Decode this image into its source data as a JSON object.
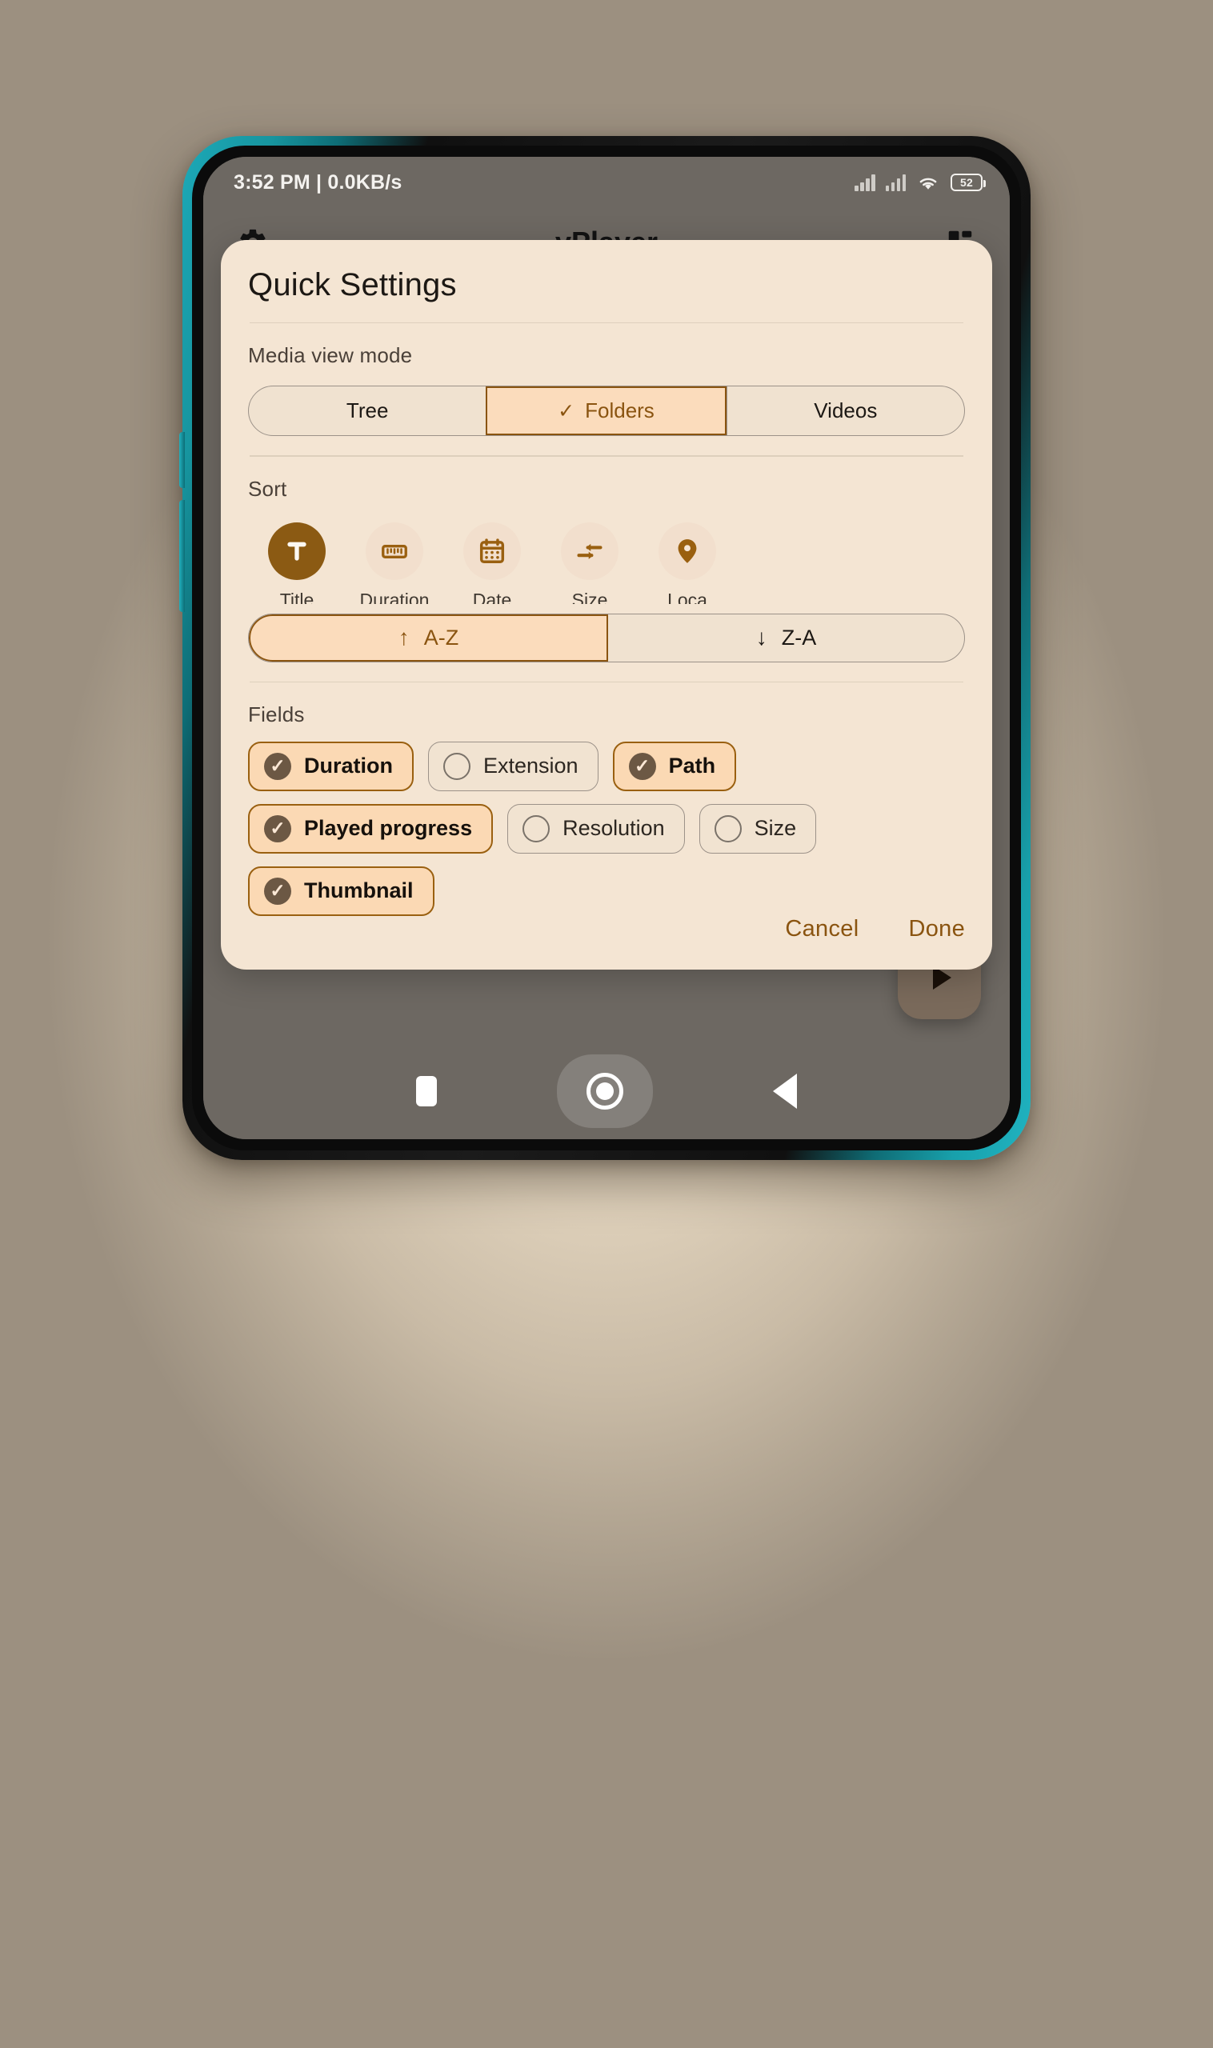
{
  "status_bar": {
    "time_and_speed": "3:52 PM | 0.0KB/s",
    "battery_level": "52",
    "icons": [
      "signal-bars-icon",
      "signal-bars-icon",
      "wifi-icon",
      "battery-icon"
    ]
  },
  "app_bar": {
    "title": "vPlayer",
    "left_icon": "gear-icon",
    "right_icon": "grid-layout-icon"
  },
  "dialog": {
    "title": "Quick Settings",
    "media_view_mode": {
      "label": "Media view mode",
      "options": [
        {
          "label": "Tree",
          "selected": false
        },
        {
          "label": "Folders",
          "selected": true
        },
        {
          "label": "Videos",
          "selected": false
        }
      ]
    },
    "sort": {
      "label": "Sort",
      "options": [
        {
          "label": "Title",
          "icon": "letter-t-icon",
          "selected": true
        },
        {
          "label": "Duration",
          "icon": "ruler-icon",
          "selected": false
        },
        {
          "label": "Date",
          "icon": "calendar-icon",
          "selected": false
        },
        {
          "label": "Size",
          "icon": "arrows-size-icon",
          "selected": false
        },
        {
          "label": "Loca",
          "icon": "map-pin-icon",
          "selected": false
        }
      ],
      "order": [
        {
          "label": "A-Z",
          "arrow": "↑",
          "selected": true
        },
        {
          "label": "Z-A",
          "arrow": "↓",
          "selected": false
        }
      ]
    },
    "fields": {
      "label": "Fields",
      "items": [
        {
          "label": "Duration",
          "checked": true
        },
        {
          "label": "Extension",
          "checked": false
        },
        {
          "label": "Path",
          "checked": true
        },
        {
          "label": "Played progress",
          "checked": true
        },
        {
          "label": "Resolution",
          "checked": false
        },
        {
          "label": "Size",
          "checked": false
        },
        {
          "label": "Thumbnail",
          "checked": true
        }
      ]
    },
    "actions": {
      "cancel": "Cancel",
      "done": "Done"
    }
  },
  "fab": {
    "icon": "play-icon"
  },
  "nav_bar": {
    "recents": "recents-square-icon",
    "home": "home-circle-icon",
    "back": "back-triangle-icon"
  },
  "colors": {
    "dialog_bg": "#f4e5d3",
    "accent_brown": "#8a5410",
    "selected_peach": "#fbdcbc",
    "scrim": "#6d6862",
    "phone_edge_teal": "#1ca9b8"
  }
}
